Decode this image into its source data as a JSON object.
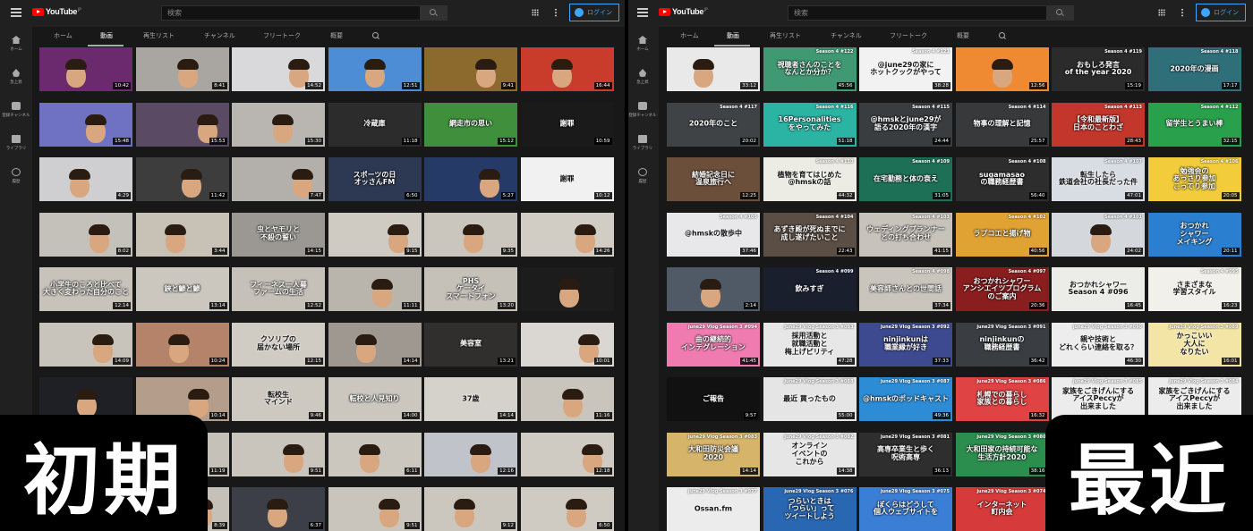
{
  "overlay": {
    "left_label": "初期",
    "right_label": "最近"
  },
  "header": {
    "logo_text": "YouTube",
    "logo_region": "JP",
    "search_placeholder": "検索",
    "login_label": "ログイン",
    "icons": {
      "menu": "hamburger-icon",
      "search": "search-icon",
      "apps": "apps-grid-icon",
      "more": "more-vert-icon",
      "account": "account-circle-icon"
    }
  },
  "sidebar": {
    "items": [
      {
        "label": "ホーム",
        "icon": "home-icon"
      },
      {
        "label": "急上昇",
        "icon": "fire-icon"
      },
      {
        "label": "登録チャンネル",
        "icon": "subscriptions-icon"
      },
      {
        "label": "ライブラリ",
        "icon": "library-icon"
      },
      {
        "label": "履歴",
        "icon": "history-icon"
      }
    ]
  },
  "tabs": {
    "items": [
      "ホーム",
      "動画",
      "再生リスト",
      "チャンネル",
      "フリートーク",
      "概要"
    ],
    "active": "動画"
  },
  "left_grid": [
    {
      "d": "10:42",
      "t": "",
      "c": "#6b2a6e"
    },
    {
      "d": "8:41",
      "t": "",
      "c": "#a9a6a2"
    },
    {
      "d": "14:52",
      "t": "",
      "c": "#d9d9db"
    },
    {
      "d": "12:51",
      "t": "",
      "c": "#4d8dd6"
    },
    {
      "d": "9:41",
      "t": "",
      "c": "#8c6a2e"
    },
    {
      "d": "16:44",
      "t": "",
      "c": "#c93b2a"
    },
    {
      "d": "15:48",
      "t": "",
      "c": "#6f72c2"
    },
    {
      "d": "15:53",
      "t": "",
      "c": "#5a4a64"
    },
    {
      "d": "15:30",
      "t": "",
      "c": "#b9b6b2"
    },
    {
      "d": "11:18",
      "t": "冷蔵庫",
      "c": "#2c2c2c"
    },
    {
      "d": "15:12",
      "t": "網走市の思い",
      "c": "#3f8f3c"
    },
    {
      "d": "10:59",
      "t": "謝罪",
      "c": "#1a1a1a"
    },
    {
      "d": "4:29",
      "t": "",
      "c": "#cfcfd1"
    },
    {
      "d": "11:42",
      "t": "",
      "c": "#3d3d3d"
    },
    {
      "d": "7:47",
      "t": "",
      "c": "#b3b0ab"
    },
    {
      "d": "6:50",
      "t": "スポーツの日\nオッさんFM",
      "c": "#2d3952"
    },
    {
      "d": "5:27",
      "t": "",
      "c": "#253a66"
    },
    {
      "d": "10:12",
      "t": "謝罪",
      "c": "#f1f1f1"
    },
    {
      "d": "8:02",
      "t": "",
      "c": "#c4c0ba"
    },
    {
      "d": "3:44",
      "t": "",
      "c": "#c7c1b6"
    },
    {
      "d": "14:15",
      "t": "虫とヤモリと\n不殺の誓い",
      "c": "#9b9893"
    },
    {
      "d": "9:15",
      "t": "",
      "c": "#cfcac2"
    },
    {
      "d": "9:35",
      "t": "",
      "c": "#cbc6bd"
    },
    {
      "d": "14:26",
      "t": "",
      "c": "#d1ccc4"
    },
    {
      "d": "12:14",
      "t": "小学生のころと比べて\n大きく変わった自分のこと",
      "c": "#c7c2ba"
    },
    {
      "d": "13:14",
      "t": "鋏と鯵と鯵",
      "c": "#cbc6be"
    },
    {
      "d": "12:52",
      "t": "フィーネス一人暮\nファームの生活",
      "c": "#c5c0b8"
    },
    {
      "d": "11:11",
      "t": "",
      "c": "#b9b4ac"
    },
    {
      "d": "13:20",
      "t": "PHS\nケータイ\nスマートフォン",
      "c": "#c5c0b8"
    },
    {
      "d": "",
      "t": "",
      "c": "#1c1c1c"
    },
    {
      "d": "14:09",
      "t": "",
      "c": "#c8c3bb"
    },
    {
      "d": "10:24",
      "t": "",
      "c": "#b4836a"
    },
    {
      "d": "12:15",
      "t": "クソリプの\n届かない場所",
      "c": "#d0cbc3"
    },
    {
      "d": "14:14",
      "t": "",
      "c": "#9e9891"
    },
    {
      "d": "13:21",
      "t": "美容室",
      "c": "#312f2d"
    },
    {
      "d": "10:01",
      "t": "",
      "c": "#dad7d2"
    },
    {
      "d": "",
      "t": "",
      "c": "#1f1f26"
    },
    {
      "d": "10:14",
      "t": "",
      "c": "#b49d8a"
    },
    {
      "d": "9:46",
      "t": "転校生\nマインド",
      "c": "#cdc8c0"
    },
    {
      "d": "14:00",
      "t": "転校と人見知り",
      "c": "#cbc6be"
    },
    {
      "d": "14:14",
      "t": "37歳",
      "c": "#d5d1cb"
    },
    {
      "d": "11:16",
      "t": "",
      "c": "#c9c4bc"
    },
    {
      "d": "",
      "t": "",
      "c": "#bfbab2"
    },
    {
      "d": "11:19",
      "t": "",
      "c": "#c5c0b8"
    },
    {
      "d": "9:51",
      "t": "",
      "c": "#c9c4bc"
    },
    {
      "d": "6:11",
      "t": "",
      "c": "#cbc6be"
    },
    {
      "d": "12:16",
      "t": "",
      "c": "#c1c3cb"
    },
    {
      "d": "12:18",
      "t": "",
      "c": "#cfcac2"
    },
    {
      "d": "",
      "t": "",
      "c": "#c8c3bb"
    },
    {
      "d": "8:39",
      "t": "",
      "c": "#c5c0b8"
    },
    {
      "d": "6:37",
      "t": "",
      "c": "#3c3f48"
    },
    {
      "d": "9:51",
      "t": "",
      "c": "#c9c4bc"
    },
    {
      "d": "9:12",
      "t": "",
      "c": "#cbc6be"
    },
    {
      "d": "6:50",
      "t": "",
      "c": "#cfcac2"
    }
  ],
  "right_grid": [
    {
      "d": "33:12",
      "t": "",
      "g": "",
      "c": "#e9e9ea"
    },
    {
      "d": "45:56",
      "t": "視聴者さんのことを\nなんとか分か？",
      "g": "Season 4 #122",
      "c": "#3f9a73"
    },
    {
      "d": "38:28",
      "t": "@june29の家に\nホットクックがやって",
      "g": "Season 4 #121",
      "c": "#f2f2f2"
    },
    {
      "d": "12:56",
      "t": "",
      "g": "",
      "c": "#f08a32"
    },
    {
      "d": "15:19",
      "t": "おもしろ発言\nof the year 2020",
      "g": "Season 4 #119",
      "c": "#2b2b2b"
    },
    {
      "d": "17:17",
      "t": "2020年の漫画",
      "g": "Season 4 #118",
      "c": "#2f6f7a"
    },
    {
      "d": "20:02",
      "t": "2020年のこと",
      "g": "Season 4 #117",
      "c": "#404346"
    },
    {
      "d": "51:18",
      "t": "16Personalities\nをやってみた",
      "g": "Season 4 #116",
      "c": "#2bb3a3"
    },
    {
      "d": "24:44",
      "t": "@hmskとjune29が\n語る2020年の漢字",
      "g": "Season 4 #115",
      "c": "#3a3d40"
    },
    {
      "d": "25:57",
      "t": "物事の理解と記憶",
      "g": "Season 4 #114",
      "c": "#37393b"
    },
    {
      "d": "28:43",
      "t": "【令和最新版】\n日本のことわざ",
      "g": "Season 4 #113",
      "c": "#c3362b"
    },
    {
      "d": "32:15",
      "t": "留学生とうまい棒",
      "g": "Season 4 #112",
      "c": "#29a04b"
    },
    {
      "d": "12:25",
      "t": "結婚記念日に\n温泉旅行へ",
      "g": "",
      "c": "#6b4f3a"
    },
    {
      "d": "44:32",
      "t": "植物を育てはじめた\n@hmskの話",
      "g": "Season 4 #110",
      "c": "#ecece4"
    },
    {
      "d": "31:05",
      "t": "在宅勤務と体の衰え",
      "g": "Season 4 #109",
      "c": "#1d6f56"
    },
    {
      "d": "56:40",
      "t": "sugamasao\nの職務経歴書",
      "g": "Season 4 #108",
      "c": "#2d2d2d"
    },
    {
      "d": "47:01",
      "t": "転生したら\n鉄道会社の社長だった件",
      "g": "Season 4 #107",
      "c": "#d8dde4"
    },
    {
      "d": "20:05",
      "t": "勉強会の\nあっさり参加\nこってり参加",
      "g": "Season 4 #106",
      "c": "#f2cc3a"
    },
    {
      "d": "37:46",
      "t": "@hmskの散歩中",
      "g": "Season 4 #105",
      "c": "#e8e8ea"
    },
    {
      "d": "22:43",
      "t": "あずき殿が死ぬまでに\n成し遂げたいこと",
      "g": "Season 4 #104",
      "c": "#5b4e44"
    },
    {
      "d": "41:15",
      "t": "ウェディングプランナー\nとの打ち合わせ",
      "g": "Season 4 #103",
      "c": "#c7c2ba"
    },
    {
      "d": "40:56",
      "t": "ラプコエと揚げ物",
      "g": "Season 4 #102",
      "c": "#e0a232"
    },
    {
      "d": "24:02",
      "t": "",
      "g": "Season 4 #101",
      "c": "#d4d8dc"
    },
    {
      "d": "20:11",
      "t": "おつかれ\nシャワー\nメイキング",
      "g": "",
      "c": "#2b7fd0"
    },
    {
      "d": "2:14",
      "t": "",
      "g": "",
      "c": "#4f5a66"
    },
    {
      "d": "",
      "t": "飲みすぎ",
      "g": "Season 4 #099",
      "c": "#1a1f2e"
    },
    {
      "d": "37:34",
      "t": "美容師さんとの世間話",
      "g": "Season 4 #098",
      "c": "#c9c4bc"
    },
    {
      "d": "20:36",
      "t": "おつかれシャワー\nアンシエイツプログラム\nのご案内",
      "g": "Season 4 #097",
      "c": "#8a1e1e"
    },
    {
      "d": "16:45",
      "t": "おつかれシャワー\nSeason 4 #096",
      "g": "",
      "c": "#ecece8"
    },
    {
      "d": "16:23",
      "t": "さまざまな\n学習スタイル",
      "g": "Season 4 #095",
      "c": "#f2f0ea"
    },
    {
      "d": "41:45",
      "t": "曲の継続的\nインテグレーション",
      "g": "june29 Vlog Season 3 #094",
      "c": "#ef7bb0"
    },
    {
      "d": "47:28",
      "t": "採用活動と\n就職活動と\n梅上げピリティ",
      "g": "june29 Vlog Season 3 #093",
      "c": "#e7e7e7"
    },
    {
      "d": "37:33",
      "t": "ninjinkunは\n職業縁が好き",
      "g": "june29 Vlog Season 3 #092",
      "c": "#3d4a8f"
    },
    {
      "d": "36:42",
      "t": "ninjinkunの\n職務経歴書",
      "g": "june29 Vlog Season 3 #091",
      "c": "#3a3d42"
    },
    {
      "d": "46:30",
      "t": "親や技術と\nどれくらい連絡を取る？",
      "g": "june29 Vlog Season 3 #090",
      "c": "#ededee"
    },
    {
      "d": "16:01",
      "t": "かっこいい\n大人に\nなりたい",
      "g": "june29 Vlog Season 3 #089",
      "c": "#f3e5a6"
    },
    {
      "d": "9:57",
      "t": "ご報告",
      "g": "",
      "c": "#111111"
    },
    {
      "d": "55:00",
      "t": "最近 買ったもの",
      "g": "june29 Vlog Season 3 #088",
      "c": "#e5e5e5"
    },
    {
      "d": "49:36",
      "t": "@hmskのポッドキャスト",
      "g": "june29 Vlog Season 3 #087",
      "c": "#2c8cd6"
    },
    {
      "d": "16:32",
      "t": "札幌での暮らし\n家族との暮らし",
      "g": "june29 Vlog Season 3 #086",
      "c": "#e04343"
    },
    {
      "d": "",
      "t": "家族をごきげんにする\nアイスPeccyが\n出来ました",
      "g": "june29 Vlog Season 3 #085",
      "c": "#ececec"
    },
    {
      "d": "",
      "t": "家族をごきげんにする\nアイスPeccyが\n出来ました",
      "g": "june29 Vlog Season 3 #084",
      "c": "#ececec"
    },
    {
      "d": "14:14",
      "t": "大和田防災会議\n2020",
      "g": "june29 Vlog Season 3 #083",
      "c": "#d6b56a"
    },
    {
      "d": "14:38",
      "t": "オンライン\nイベントの\nこれから",
      "g": "june29 Vlog Season 3 #082",
      "c": "#e6e6e6"
    },
    {
      "d": "36:13",
      "t": "高専卒業生と歩く\n呪術高専",
      "g": "june29 Vlog Season 3 #081",
      "c": "#2e2e2e"
    },
    {
      "d": "38:16",
      "t": "大和田家の持続可能な\n生活方針2020",
      "g": "june29 Vlog Season 3 #080",
      "c": "#2b8e4e"
    },
    {
      "d": "",
      "t": "",
      "g": "",
      "c": "#1c1c1c"
    },
    {
      "d": "",
      "t": "",
      "g": "",
      "c": "#1c1c1c"
    },
    {
      "d": "",
      "t": "Ossan.fm",
      "g": "june29 Vlog Season 3 #077",
      "c": "#ececec"
    },
    {
      "d": "",
      "t": "つらいときは\n「つらい」って\nツイートしよう",
      "g": "june29 Vlog Season 3 #076",
      "c": "#2a67b2"
    },
    {
      "d": "",
      "t": "ぼくらはどうして\n個人ウェブサイトを",
      "g": "june29 Vlog Season 3 #075",
      "c": "#3b7ed6"
    },
    {
      "d": "",
      "t": "インターネット\n町内会",
      "g": "june29 Vlog Season 3 #074",
      "c": "#d63a3a"
    },
    {
      "d": "",
      "t": "",
      "g": "",
      "c": "#1c1c1c"
    },
    {
      "d": "",
      "t": "",
      "g": "",
      "c": "#1c1c1c"
    }
  ]
}
